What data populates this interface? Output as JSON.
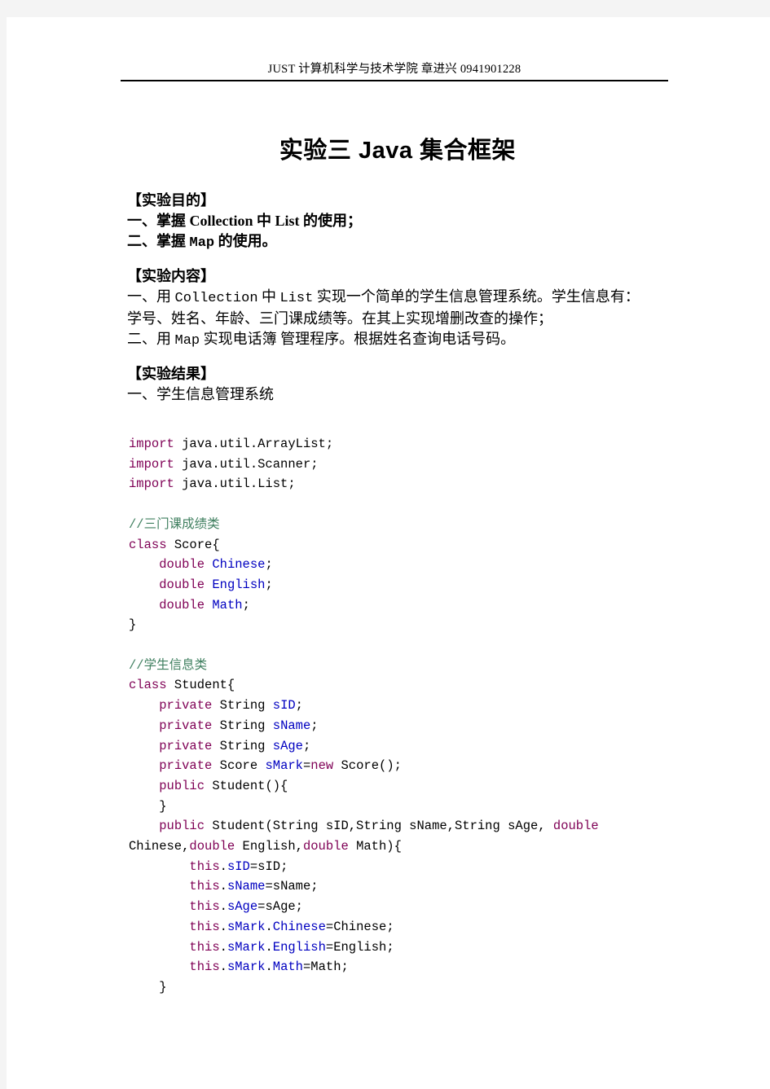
{
  "document": {
    "header": "JUST  计算机科学与技术学院  章进兴  0941901228",
    "title": "实验三 Java 集合框架"
  },
  "sections": [
    {
      "heading": "【实验目的】",
      "lines": [
        [
          {
            "t": "一、掌握 ",
            "s": "serif"
          },
          {
            "t": "Collection",
            "s": "serif-bold"
          },
          {
            "t": " 中 ",
            "s": "serif"
          },
          {
            "t": "List",
            "s": "serif-bold"
          },
          {
            "t": " 的使用；",
            "s": "serif"
          }
        ],
        [
          {
            "t": "二、掌握 ",
            "s": "serif"
          },
          {
            "t": "Map",
            "s": "mono"
          },
          {
            "t": " 的使用。",
            "s": "serif"
          }
        ]
      ]
    },
    {
      "heading": "【实验内容】",
      "lines": [
        [
          {
            "t": "一、用 ",
            "s": "serif"
          },
          {
            "t": "Collection",
            "s": "mono"
          },
          {
            "t": " 中 ",
            "s": "serif"
          },
          {
            "t": "List",
            "s": "mono"
          },
          {
            "t": " 实现一个简单的学生信息管理系统。学生信息有：",
            "s": "serif"
          }
        ],
        [
          {
            "t": "学号、姓名、年龄、三门课成绩等。在其上实现增删改查的操作；",
            "s": "serif"
          }
        ],
        [
          {
            "t": "二、用 ",
            "s": "serif"
          },
          {
            "t": "Map",
            "s": "mono"
          },
          {
            "t": " 实现电话簿 管理程序。根据姓名查询电话号码。",
            "s": "serif"
          }
        ]
      ]
    },
    {
      "heading": "【实验结果】",
      "lines": [
        [
          {
            "t": "一、学生信息管理系统",
            "s": "serif"
          }
        ]
      ]
    }
  ],
  "code_lines": [
    [
      {
        "t": "import",
        "c": "kw"
      },
      {
        "t": " java.util.ArrayList;",
        "c": "pl"
      }
    ],
    [
      {
        "t": "import",
        "c": "kw"
      },
      {
        "t": " java.util.Scanner;",
        "c": "pl"
      }
    ],
    [
      {
        "t": "import",
        "c": "kw"
      },
      {
        "t": " java.util.List;",
        "c": "pl"
      }
    ],
    [],
    [
      {
        "t": "//三门课成绩类",
        "c": "cm"
      }
    ],
    [
      {
        "t": "class",
        "c": "kw"
      },
      {
        "t": " Score{",
        "c": "pl"
      }
    ],
    [
      {
        "t": "    ",
        "c": "pl"
      },
      {
        "t": "double",
        "c": "kw"
      },
      {
        "t": " ",
        "c": "pl"
      },
      {
        "t": "Chinese",
        "c": "id"
      },
      {
        "t": ";",
        "c": "pl"
      }
    ],
    [
      {
        "t": "    ",
        "c": "pl"
      },
      {
        "t": "double",
        "c": "kw"
      },
      {
        "t": " ",
        "c": "pl"
      },
      {
        "t": "English",
        "c": "id"
      },
      {
        "t": ";",
        "c": "pl"
      }
    ],
    [
      {
        "t": "    ",
        "c": "pl"
      },
      {
        "t": "double",
        "c": "kw"
      },
      {
        "t": " ",
        "c": "pl"
      },
      {
        "t": "Math",
        "c": "id"
      },
      {
        "t": ";",
        "c": "pl"
      }
    ],
    [
      {
        "t": "}",
        "c": "pl"
      }
    ],
    [],
    [
      {
        "t": "//学生信息类",
        "c": "cm"
      }
    ],
    [
      {
        "t": "class",
        "c": "kw"
      },
      {
        "t": " Student{",
        "c": "pl"
      }
    ],
    [
      {
        "t": "    ",
        "c": "pl"
      },
      {
        "t": "private",
        "c": "kw"
      },
      {
        "t": " String ",
        "c": "pl"
      },
      {
        "t": "sID",
        "c": "id"
      },
      {
        "t": ";",
        "c": "pl"
      }
    ],
    [
      {
        "t": "    ",
        "c": "pl"
      },
      {
        "t": "private",
        "c": "kw"
      },
      {
        "t": " String ",
        "c": "pl"
      },
      {
        "t": "sName",
        "c": "id"
      },
      {
        "t": ";",
        "c": "pl"
      }
    ],
    [
      {
        "t": "    ",
        "c": "pl"
      },
      {
        "t": "private",
        "c": "kw"
      },
      {
        "t": " String ",
        "c": "pl"
      },
      {
        "t": "sAge",
        "c": "id"
      },
      {
        "t": ";",
        "c": "pl"
      }
    ],
    [
      {
        "t": "    ",
        "c": "pl"
      },
      {
        "t": "private",
        "c": "kw"
      },
      {
        "t": " Score ",
        "c": "pl"
      },
      {
        "t": "sMark",
        "c": "id"
      },
      {
        "t": "=",
        "c": "pl"
      },
      {
        "t": "new",
        "c": "kw"
      },
      {
        "t": " Score();",
        "c": "pl"
      }
    ],
    [
      {
        "t": "    ",
        "c": "pl"
      },
      {
        "t": "public",
        "c": "kw"
      },
      {
        "t": " Student(){",
        "c": "pl"
      }
    ],
    [
      {
        "t": "    }",
        "c": "pl"
      }
    ],
    [
      {
        "t": "    ",
        "c": "pl"
      },
      {
        "t": "public",
        "c": "kw"
      },
      {
        "t": " Student(String sID,String sName,String sAge, ",
        "c": "pl"
      },
      {
        "t": "double",
        "c": "kw"
      }
    ],
    [
      {
        "t": "Chinese,",
        "c": "pl"
      },
      {
        "t": "double",
        "c": "kw"
      },
      {
        "t": " English,",
        "c": "pl"
      },
      {
        "t": "double",
        "c": "kw"
      },
      {
        "t": " Math){",
        "c": "pl"
      }
    ],
    [
      {
        "t": "        ",
        "c": "pl"
      },
      {
        "t": "this",
        "c": "kw"
      },
      {
        "t": ".",
        "c": "pl"
      },
      {
        "t": "sID",
        "c": "id"
      },
      {
        "t": "=sID;",
        "c": "pl"
      }
    ],
    [
      {
        "t": "        ",
        "c": "pl"
      },
      {
        "t": "this",
        "c": "kw"
      },
      {
        "t": ".",
        "c": "pl"
      },
      {
        "t": "sName",
        "c": "id"
      },
      {
        "t": "=sName;",
        "c": "pl"
      }
    ],
    [
      {
        "t": "        ",
        "c": "pl"
      },
      {
        "t": "this",
        "c": "kw"
      },
      {
        "t": ".",
        "c": "pl"
      },
      {
        "t": "sAge",
        "c": "id"
      },
      {
        "t": "=sAge;",
        "c": "pl"
      }
    ],
    [
      {
        "t": "        ",
        "c": "pl"
      },
      {
        "t": "this",
        "c": "kw"
      },
      {
        "t": ".",
        "c": "pl"
      },
      {
        "t": "sMark",
        "c": "id"
      },
      {
        "t": ".",
        "c": "pl"
      },
      {
        "t": "Chinese",
        "c": "id"
      },
      {
        "t": "=Chinese;",
        "c": "pl"
      }
    ],
    [
      {
        "t": "        ",
        "c": "pl"
      },
      {
        "t": "this",
        "c": "kw"
      },
      {
        "t": ".",
        "c": "pl"
      },
      {
        "t": "sMark",
        "c": "id"
      },
      {
        "t": ".",
        "c": "pl"
      },
      {
        "t": "English",
        "c": "id"
      },
      {
        "t": "=English;",
        "c": "pl"
      }
    ],
    [
      {
        "t": "        ",
        "c": "pl"
      },
      {
        "t": "this",
        "c": "kw"
      },
      {
        "t": ".",
        "c": "pl"
      },
      {
        "t": "sMark",
        "c": "id"
      },
      {
        "t": ".",
        "c": "pl"
      },
      {
        "t": "Math",
        "c": "id"
      },
      {
        "t": "=Math;",
        "c": "pl"
      }
    ],
    [
      {
        "t": "    }",
        "c": "pl"
      }
    ]
  ],
  "colors": {
    "keyword": "#7f0055",
    "comment": "#3f7f5f",
    "identifier": "#0000c0",
    "plain": "#000000",
    "page": "#ffffff",
    "canvas": "#f4f4f4"
  }
}
